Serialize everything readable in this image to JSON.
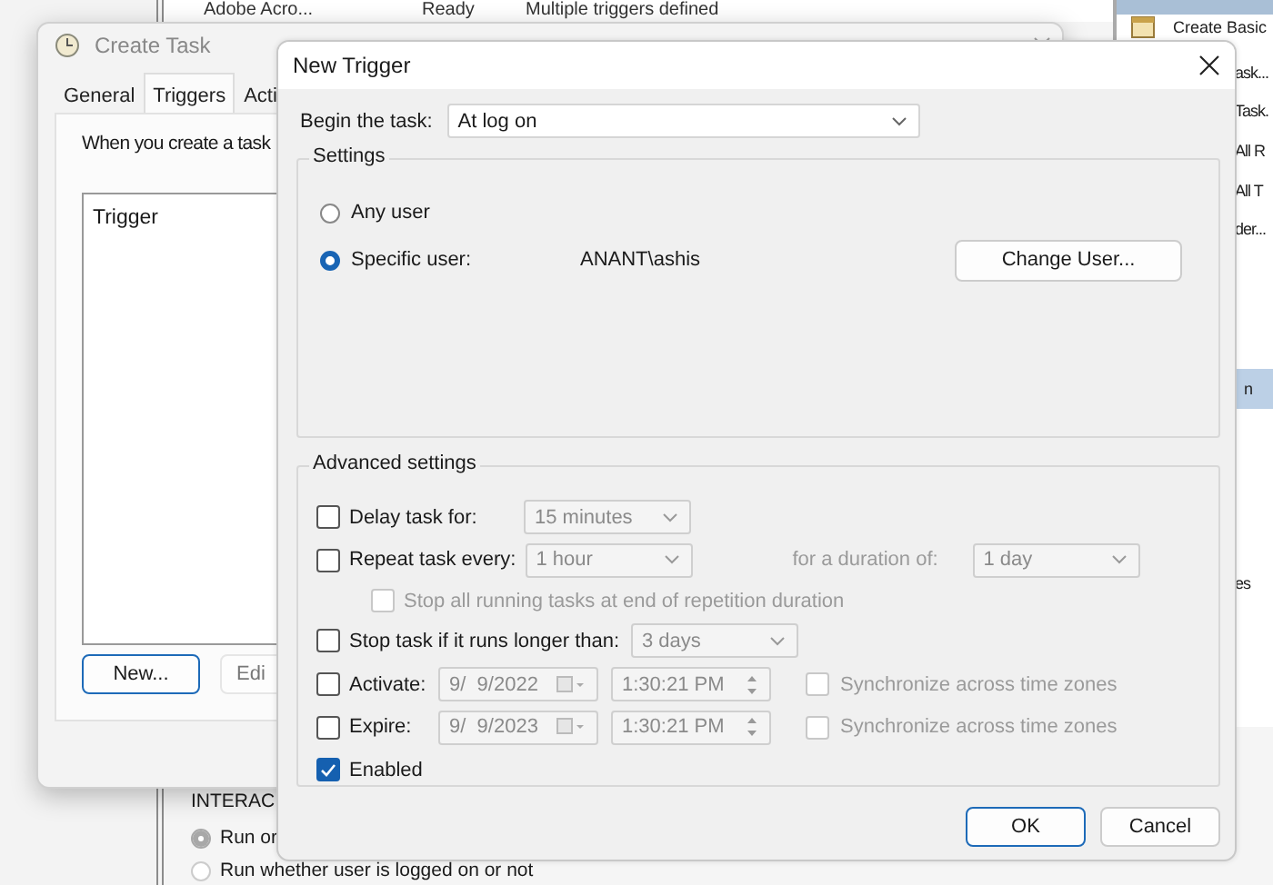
{
  "scheduler_window": {
    "list_row": {
      "name": "Adobe Acro...",
      "status": "Ready",
      "triggers": "Multiple triggers defined"
    },
    "actions": [
      {
        "label": "Create Basic",
        "selected": false
      },
      {
        "label": "ask...",
        "selected": false
      },
      {
        "label": "Task.",
        "selected": false
      },
      {
        "label": "All R",
        "selected": false
      },
      {
        "label": "All T",
        "selected": false
      },
      {
        "label": "der...",
        "selected": false
      },
      {
        "label": "n",
        "selected": true
      },
      {
        "label": "es",
        "selected": false
      }
    ],
    "security": {
      "heading": "INTERAC",
      "options": [
        {
          "label": "Run or",
          "selected": true
        },
        {
          "label": "Run whether user is logged on or not",
          "selected": false
        }
      ]
    }
  },
  "create_task": {
    "title": "Create Task",
    "tabs": [
      {
        "label": "General",
        "selected": false
      },
      {
        "label": "Triggers",
        "selected": true
      },
      {
        "label": "Acti",
        "selected": false
      }
    ],
    "intro": "When you create a task",
    "list_header": "Trigger",
    "buttons": [
      {
        "label": "New...",
        "default": true
      },
      {
        "label": "Edi",
        "default": false
      }
    ]
  },
  "new_trigger": {
    "title": "New Trigger",
    "begin_label": "Begin the task:",
    "begin_value": "At log on",
    "settings": {
      "title": "Settings",
      "options": [
        {
          "label": "Any user",
          "selected": false
        },
        {
          "label": "Specific user:",
          "selected": true
        }
      ],
      "user": "ANANT\\ashis",
      "change_button": "Change User..."
    },
    "advanced": {
      "title": "Advanced settings",
      "delay": {
        "label": "Delay task for:",
        "checked": false,
        "value": "15 minutes",
        "disabled": true
      },
      "repeat": {
        "label": "Repeat task every:",
        "checked": false,
        "value": "1 hour",
        "disabled": true,
        "duration_label": "for a duration of:",
        "duration_value": "1 day"
      },
      "stop_all": {
        "label": "Stop all running tasks at end of repetition duration",
        "checked": false,
        "disabled": true
      },
      "stop_longer": {
        "label": "Stop task if it runs longer than:",
        "checked": false,
        "value": "3 days",
        "disabled": true
      },
      "schedule": [
        {
          "label": "Activate:",
          "checked": false,
          "date": "9/  9/2022",
          "time": "1:30:21 PM",
          "sync_label": "Synchronize across time zones",
          "sync_checked": false,
          "disabled": true
        },
        {
          "label": "Expire:",
          "checked": false,
          "date": "9/  9/2023",
          "time": "1:30:21 PM",
          "sync_label": "Synchronize across time zones",
          "sync_checked": false,
          "disabled": true
        }
      ],
      "enabled": {
        "label": "Enabled",
        "checked": true
      }
    },
    "buttons": [
      {
        "label": "OK",
        "default": true
      },
      {
        "label": "Cancel",
        "default": false
      }
    ]
  }
}
